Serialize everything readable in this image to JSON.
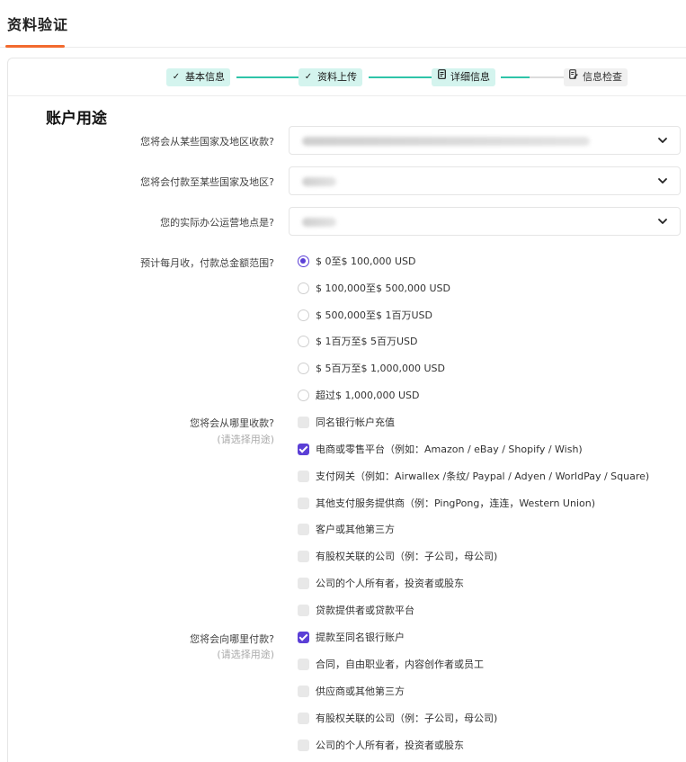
{
  "header": {
    "title": "资料验证"
  },
  "stepper": {
    "steps": [
      {
        "label": "基本信息",
        "state": "done",
        "icon": "check-icon"
      },
      {
        "label": "资料上传",
        "state": "done",
        "icon": "check-icon"
      },
      {
        "label": "详细信息",
        "state": "current",
        "icon": "document-icon"
      },
      {
        "label": "信息检查",
        "state": "todo",
        "icon": "edit-document-icon"
      }
    ]
  },
  "section": {
    "title": "账户用途"
  },
  "questions": {
    "receive_countries": {
      "label": "您将会从某些国家及地区收款?"
    },
    "pay_countries": {
      "label": "您将会付款至某些国家及地区?"
    },
    "office_location": {
      "label": "您的实际办公运营地点是?"
    },
    "monthly_amount": {
      "label": "预计每月收，付款总金额范围?",
      "options": [
        {
          "label": "$ 0至$ 100,000 USD",
          "selected": true
        },
        {
          "label": "$ 100,000至$ 500,000 USD",
          "selected": false
        },
        {
          "label": "$ 500,000至$ 1百万USD",
          "selected": false
        },
        {
          "label": "$ 1百万至$ 5百万USD",
          "selected": false
        },
        {
          "label": "$ 5百万至$ 1,000,000 USD",
          "selected": false
        },
        {
          "label": "超过$ 1,000,000 USD",
          "selected": false
        }
      ]
    },
    "receive_from": {
      "label": "您将会从哪里收款?",
      "hint": "(请选择用途)",
      "options": [
        {
          "label": "同名银行帐户充值",
          "checked": false
        },
        {
          "label": "电商或零售平台（例如：Amazon / eBay / Shopify / Wish)",
          "checked": true
        },
        {
          "label": "支付网关（例如：Airwallex /条纹/ Paypal / Adyen / WorldPay / Square)",
          "checked": false
        },
        {
          "label": "其他支付服务提供商（例：PingPong，连连，Western Union)",
          "checked": false
        },
        {
          "label": "客户或其他第三方",
          "checked": false
        },
        {
          "label": "有股权关联的公司（例：子公司，母公司)",
          "checked": false
        },
        {
          "label": "公司的个人所有者，投资者或股东",
          "checked": false
        },
        {
          "label": "贷款提供者或贷款平台",
          "checked": false
        }
      ]
    },
    "pay_to": {
      "label": "您将会向哪里付款?",
      "hint": "(请选择用途)",
      "options": [
        {
          "label": "提款至同名银行账户",
          "checked": true
        },
        {
          "label": "合同，自由职业者，内容创作者或员工",
          "checked": false
        },
        {
          "label": "供应商或其他第三方",
          "checked": false
        },
        {
          "label": "有股权关联的公司（例：子公司，母公司)",
          "checked": false
        },
        {
          "label": "公司的个人所有者，投资者或股东",
          "checked": false
        }
      ]
    }
  },
  "colors": {
    "accent": "#5b3fd6",
    "step_active": "#2fc4a8",
    "step_bg": "#d4f4ee",
    "title_underline": "#f26a2e"
  }
}
